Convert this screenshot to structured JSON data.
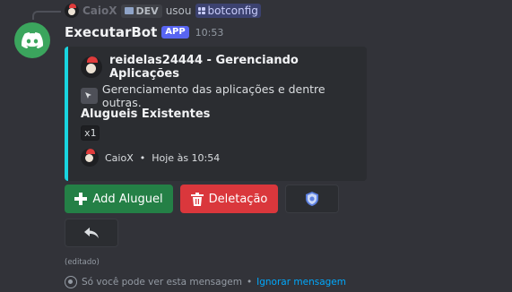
{
  "reply": {
    "user": "CaioX",
    "badge": "DEV",
    "action": "usou",
    "command": "botconfig"
  },
  "message": {
    "bot_name": "ExecutarBot",
    "bot_badge": "APP",
    "time": "10:53",
    "edited": "(editado)"
  },
  "embed": {
    "accent_color": "#19d5e0",
    "author": "reidelas24444 - Gerenciando Aplicações",
    "description": "Gerenciamento das aplicações e dentre outras.",
    "field_name": "Alugueis Existentes",
    "field_value": "x1",
    "footer_user": "CaioX",
    "footer_sep": "•",
    "footer_time": "Hoje às 10:54"
  },
  "buttons": {
    "add": {
      "label": "Add Aluguel",
      "icon": "plus-icon",
      "color": "#248046"
    },
    "delete": {
      "label": "Deletação",
      "icon": "trash-icon",
      "color": "#da373c"
    },
    "config": {
      "icon": "shield-gear-icon"
    },
    "back": {
      "icon": "reply-arrow-icon"
    }
  },
  "ephemeral": {
    "text": "Só você pode ver esta mensagem",
    "sep": "•",
    "dismiss": "Ignorar mensagem"
  }
}
